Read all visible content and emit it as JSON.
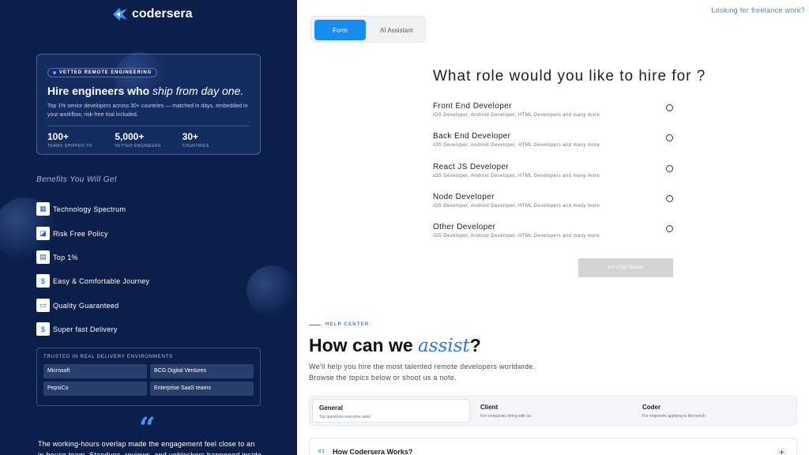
{
  "brand": {
    "name": "codersera"
  },
  "hero": {
    "pill": "VETTED REMOTE ENGINEERING",
    "title_plain": "Hire engineers who ",
    "title_italic": "ship from day one.",
    "description": "Top 1% senior developers across 30+ countries — matched in days, embedded in your workflow, risk-free trial included.",
    "stats": [
      {
        "num": "100+",
        "label": "TEAMS SHIPPED TO"
      },
      {
        "num": "5,000+",
        "label": "VETTED ENGINEERS"
      },
      {
        "num": "30+",
        "label": "COUNTRIES"
      }
    ]
  },
  "benefits": {
    "heading": "Benefits You Will Get",
    "items": [
      {
        "label": "Technology Spectrum",
        "icon": "grid-icon"
      },
      {
        "label": "Risk Free Policy",
        "icon": "shield-icon"
      },
      {
        "label": "Top 1%",
        "icon": "star-icon"
      },
      {
        "label": "Easy & Comfortable Journey",
        "icon": "dollar-icon"
      },
      {
        "label": "Quality Guaranteed",
        "icon": "chat-icon"
      },
      {
        "label": "Super fast Delivery",
        "icon": "dollar-icon"
      }
    ]
  },
  "trust": {
    "title": "TRUSTED IN REAL DELIVERY ENVIRONMENTS",
    "items": [
      "Microsoft",
      "BCG Digital Ventures",
      "PepsiCo",
      "Enterprise SaaS teams"
    ]
  },
  "testimonial": {
    "text": "The working-hours overlap made the engagement feel close to an in-house team. Standups, reviews, and unblockers happened inside the"
  },
  "header": {
    "freelance_link": "Looking for freelance work?"
  },
  "mode_tabs": {
    "form": "Form",
    "ai": "AI Assistant"
  },
  "form": {
    "question": "What role would you like to hire for ?",
    "roles": [
      {
        "name": "Front End Developer",
        "sub": "iOS Developer, Android Developer, HTML Developers and many more"
      },
      {
        "name": "Back End Developer",
        "sub": "iOS Developer, Android Developer, HTML Developers and many more"
      },
      {
        "name": "React JS Developer",
        "sub": "iOS Developer, Android Developer, HTML Developers and many more"
      },
      {
        "name": "Node Developer",
        "sub": "iOS Developer, Android Developer, HTML Developers and many more"
      },
      {
        "name": "Other Developer",
        "sub": "iOS Developer, Android Developer, HTML Developers and many more"
      }
    ],
    "submit": "Let's Get Started"
  },
  "help": {
    "label": "HELP CENTER",
    "title_a": "How can we ",
    "title_b": "assist",
    "title_c": "?",
    "description": "We'll help you hire the most talented remote developers worldwide. Browse the topics below or shoot us a note.",
    "categories": [
      {
        "name": "General",
        "sub": "Top questions everyone asks."
      },
      {
        "name": "Client",
        "sub": "For companies hiring with us."
      },
      {
        "name": "Coder",
        "sub": "For engineers applying to the bench."
      }
    ],
    "faq": {
      "num": "01",
      "question": "How Codersera Works?"
    }
  },
  "colors": {
    "panel": "#0b1f4a",
    "accent": "#1a8cf0",
    "link": "#4a86d8"
  }
}
